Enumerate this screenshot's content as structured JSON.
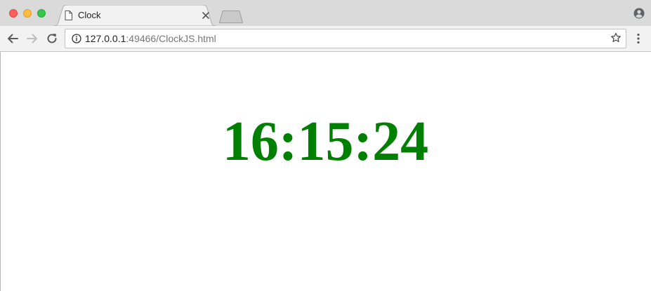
{
  "browser": {
    "tab": {
      "title": "Clock"
    },
    "address_bar": {
      "url_host": "127.0.0.1",
      "url_rest": ":49466/ClockJS.html"
    }
  },
  "page": {
    "time_text": "16:15:24",
    "time_color": "#008000"
  },
  "icons": {
    "window_controls": [
      "close-traffic-light",
      "minimize-traffic-light",
      "zoom-traffic-light"
    ],
    "tab": [
      "page-icon",
      "close-icon"
    ],
    "toolbar": [
      "back-arrow-icon",
      "forward-arrow-icon",
      "reload-icon",
      "info-icon",
      "star-icon",
      "menu-icon",
      "profile-icon"
    ]
  }
}
